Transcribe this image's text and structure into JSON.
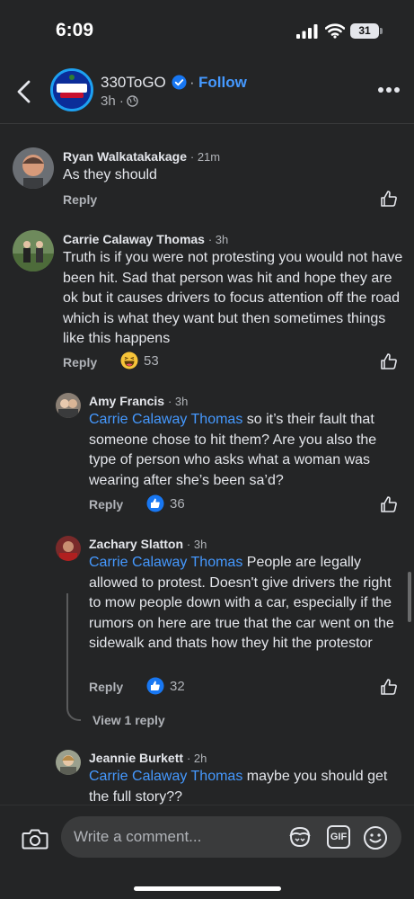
{
  "status_bar": {
    "time": "6:09",
    "battery": "31"
  },
  "header": {
    "page_name": "330ToGO",
    "separator": "·",
    "follow_label": "Follow",
    "post_time": "3h ·"
  },
  "comments": [
    {
      "author": "Ryan Walkatakakage",
      "time": "· 21m",
      "text": "As they should",
      "reply_label": "Reply"
    },
    {
      "author": "Carrie Calaway Thomas",
      "time": "· 3h",
      "text": "Truth is if you were not protesting you would not have been hit. Sad that person was hit and hope they are ok but it causes drivers to  focus attention off the road which is what they want but then sometimes things like this happens",
      "reply_label": "Reply",
      "reaction_count": "53"
    },
    {
      "author": "Amy Francis",
      "time": "· 3h",
      "mention": "Carrie Calaway Thomas",
      "text": " so it’s their fault that someone chose to hit them? Are you also the type of person who asks what a woman was wearing after she’s been sa’d?",
      "reply_label": "Reply",
      "reaction_count": "36"
    },
    {
      "author": "Zachary Slatton",
      "time": "· 3h",
      "mention": "Carrie Calaway Thomas",
      "text": " People are legally allowed to protest. Doesn't give drivers the right to mow people down with a car, especially if the rumors on here are true that the car went on the sidewalk and thats how they hit the protestor",
      "reply_label": "Reply",
      "reaction_count": "32",
      "view_replies": "View 1 reply"
    },
    {
      "author": "Jeannie Burkett",
      "time": "· 2h",
      "mention": "Carrie Calaway Thomas",
      "text": " maybe you should get the full story??"
    }
  ],
  "composer": {
    "placeholder": "Write a comment...",
    "gif_label": "GIF"
  },
  "colors": {
    "background": "#242526",
    "accent": "#4599ff",
    "secondary_text": "#b0b3b8"
  },
  "icons": [
    "back-icon",
    "verified-icon",
    "globe-icon",
    "more-icon",
    "like-icon",
    "haha-reaction-icon",
    "like-reaction-icon",
    "camera-icon",
    "avatar-sticker-icon",
    "gif-icon",
    "emoji-icon"
  ]
}
